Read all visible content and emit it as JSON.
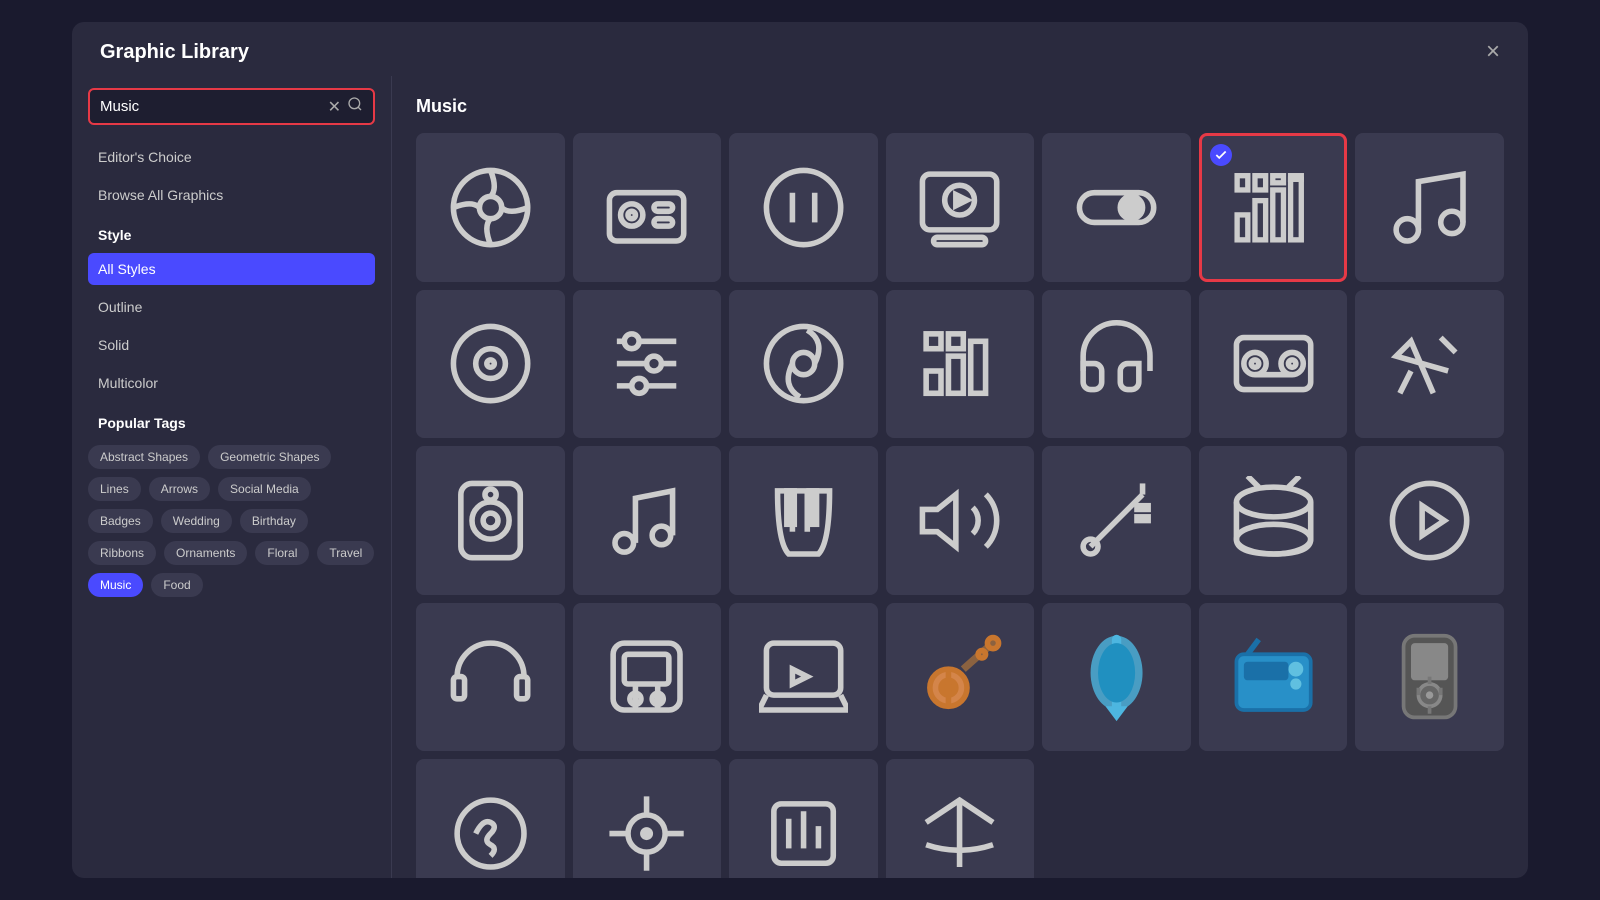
{
  "modal": {
    "title": "Graphic Library",
    "close_label": "×"
  },
  "sidebar": {
    "search": {
      "value": "Music",
      "placeholder": "Search"
    },
    "links": [
      {
        "id": "editors-choice",
        "label": "Editor's Choice"
      },
      {
        "id": "browse-all",
        "label": "Browse All Graphics"
      }
    ],
    "style_section": "Style",
    "styles": [
      {
        "id": "all",
        "label": "All Styles",
        "active": true
      },
      {
        "id": "outline",
        "label": "Outline",
        "active": false
      },
      {
        "id": "solid",
        "label": "Solid",
        "active": false
      },
      {
        "id": "multicolor",
        "label": "Multicolor",
        "active": false
      }
    ],
    "tags_section": "Popular Tags",
    "tags": [
      {
        "id": "abstract",
        "label": "Abstract Shapes",
        "active": false
      },
      {
        "id": "geometric",
        "label": "Geometric Shapes",
        "active": false
      },
      {
        "id": "lines",
        "label": "Lines",
        "active": false
      },
      {
        "id": "arrows",
        "label": "Arrows",
        "active": false
      },
      {
        "id": "social",
        "label": "Social Media",
        "active": false
      },
      {
        "id": "badges",
        "label": "Badges",
        "active": false
      },
      {
        "id": "wedding",
        "label": "Wedding",
        "active": false
      },
      {
        "id": "birthday",
        "label": "Birthday",
        "active": false
      },
      {
        "id": "ribbons",
        "label": "Ribbons",
        "active": false
      },
      {
        "id": "ornaments",
        "label": "Ornaments",
        "active": false
      },
      {
        "id": "floral",
        "label": "Floral",
        "active": false
      },
      {
        "id": "travel",
        "label": "Travel",
        "active": false
      },
      {
        "id": "music",
        "label": "Music",
        "active": true
      },
      {
        "id": "food",
        "label": "Food",
        "active": false
      }
    ]
  },
  "main": {
    "section_title": "Music",
    "icons": [
      {
        "id": "vinyl",
        "type": "outline",
        "selected": false
      },
      {
        "id": "radio",
        "type": "outline",
        "selected": false
      },
      {
        "id": "pause",
        "type": "outline",
        "selected": false
      },
      {
        "id": "media-player",
        "type": "outline",
        "selected": false
      },
      {
        "id": "toggle",
        "type": "outline",
        "selected": false
      },
      {
        "id": "equalizer",
        "type": "outline",
        "selected": true
      },
      {
        "id": "music-note",
        "type": "outline",
        "selected": false
      },
      {
        "id": "vinyl2",
        "type": "outline",
        "selected": false
      },
      {
        "id": "mixer",
        "type": "outline",
        "selected": false
      },
      {
        "id": "music-disc",
        "type": "outline",
        "selected": false
      },
      {
        "id": "bars",
        "type": "outline",
        "selected": false
      },
      {
        "id": "earphones",
        "type": "outline",
        "selected": false
      },
      {
        "id": "cassette",
        "type": "outline",
        "selected": false
      },
      {
        "id": "microphone",
        "type": "outline",
        "selected": false
      },
      {
        "id": "speaker",
        "type": "outline",
        "selected": false
      },
      {
        "id": "music-notes",
        "type": "outline",
        "selected": false
      },
      {
        "id": "piano",
        "type": "outline",
        "selected": false
      },
      {
        "id": "volume",
        "type": "outline",
        "selected": false
      },
      {
        "id": "aux-cable",
        "type": "outline",
        "selected": false
      },
      {
        "id": "drum",
        "type": "outline",
        "selected": false
      },
      {
        "id": "play-circle",
        "type": "outline",
        "selected": false
      },
      {
        "id": "headphones",
        "type": "outline",
        "selected": false
      },
      {
        "id": "music-player",
        "type": "multicolor",
        "selected": false
      },
      {
        "id": "laptop-music",
        "type": "outline",
        "selected": false
      },
      {
        "id": "guitar",
        "type": "multicolor",
        "selected": false
      },
      {
        "id": "usb",
        "type": "multicolor",
        "selected": false
      },
      {
        "id": "radio2",
        "type": "multicolor",
        "selected": false
      },
      {
        "id": "ipod",
        "type": "multicolor",
        "selected": false
      },
      {
        "id": "icon29",
        "type": "outline",
        "selected": false
      },
      {
        "id": "icon30",
        "type": "outline",
        "selected": false
      },
      {
        "id": "icon31",
        "type": "outline",
        "selected": false
      },
      {
        "id": "icon32",
        "type": "outline",
        "selected": false
      }
    ]
  }
}
